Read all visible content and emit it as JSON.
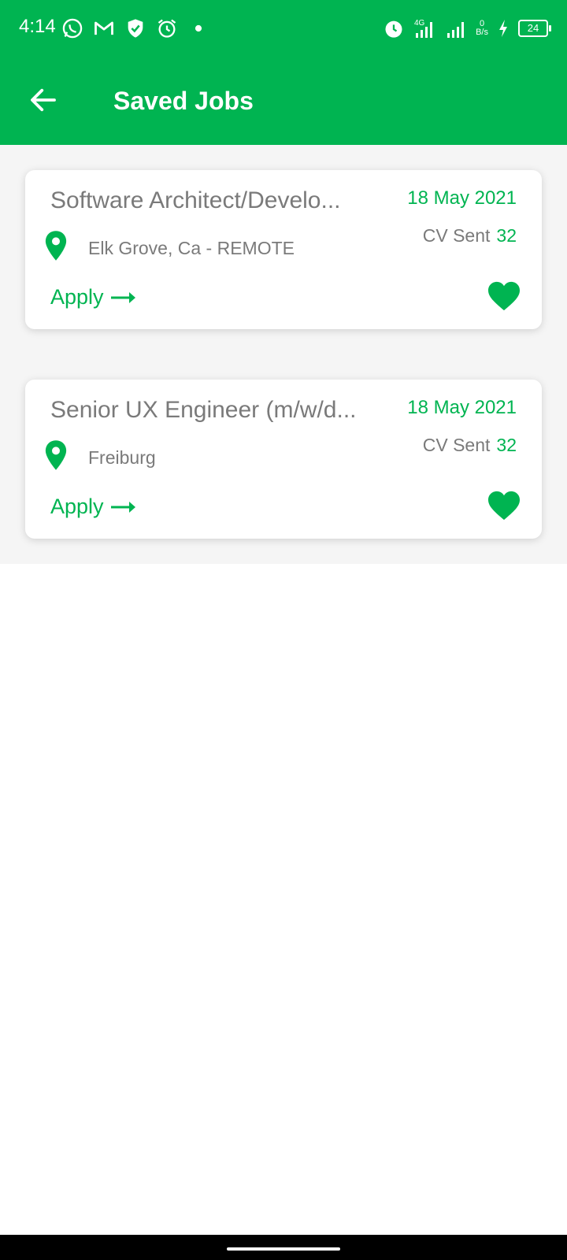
{
  "status_bar": {
    "time": "4:14",
    "network": "4G",
    "speed_value": "0",
    "speed_unit": "B/s",
    "battery": "24",
    "icons_left": [
      "whatsapp-icon",
      "gmail-icon",
      "shield-icon",
      "alarm-icon",
      "dot-icon"
    ],
    "icons_right": [
      "alarm-icon",
      "signal-icon",
      "signal-icon",
      "charging-icon",
      "battery-icon"
    ]
  },
  "app_bar": {
    "title": "Saved Jobs",
    "back_icon": "arrow-left-icon"
  },
  "jobs": [
    {
      "title": "Software Architect/Develo...",
      "date": "18 May 2021",
      "cv_sent_label": "CV Sent",
      "cv_sent_count": "32",
      "location": "Elk Grove, Ca - REMOTE",
      "apply_label": "Apply",
      "saved": true
    },
    {
      "title": "Senior UX Engineer (m/w/d...",
      "date": "18 May 2021",
      "cv_sent_label": "CV Sent",
      "cv_sent_count": "32",
      "location": "Freiburg",
      "apply_label": "Apply",
      "saved": true
    }
  ],
  "colors": {
    "brand_green": "#00b451",
    "text_gray": "#7a7a7a",
    "section_bg": "#f5f5f5"
  }
}
